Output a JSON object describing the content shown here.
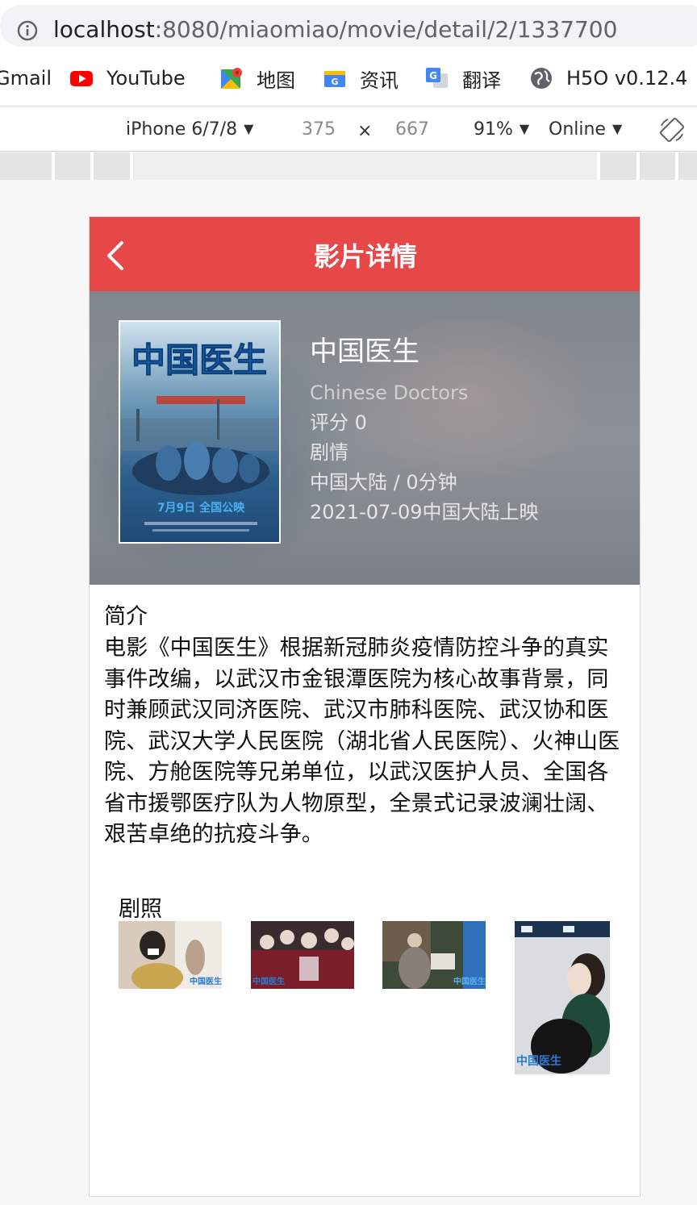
{
  "browser": {
    "url_host": "localhost",
    "url_rest": ":8080/miaomiao/movie/detail/2/1337700",
    "bookmarks": [
      {
        "label": "Gmail",
        "icon": "gmail-icon"
      },
      {
        "label": "YouTube",
        "icon": "youtube-icon"
      },
      {
        "label": "地图",
        "icon": "maps-icon"
      },
      {
        "label": "资讯",
        "icon": "news-icon"
      },
      {
        "label": "翻译",
        "icon": "translate-icon"
      },
      {
        "label": "H5O v0.12.4",
        "icon": "globe-icon"
      }
    ],
    "devtools": {
      "device": "iPhone 6/7/8",
      "width": "375",
      "times": "×",
      "height": "667",
      "zoom": "91%",
      "network": "Online",
      "dropdown_glyph": "▼"
    }
  },
  "app": {
    "header_title": "影片详情",
    "movie": {
      "name": "中国医生",
      "english_name": "Chinese Doctors",
      "score": "评分 0",
      "genre": "剧情",
      "region_duration": "中国大陆 / 0分钟",
      "release": "2021-07-09中国大陆上映"
    },
    "intro_label": "简介",
    "intro_text": "电影《中国医生》根据新冠肺炎疫情防控斗争的真实事件改编，以武汉市金银潭医院为核心故事背景，同时兼顾武汉同济医院、武汉市肺科医院、武汉协和医院、武汉大学人民医院（湖北省人民医院）、火神山医院、方舱医院等兄弟单位，以武汉医护人员、全国各省市援鄂医疗队为人物原型，全景式记录波澜壮阔、艰苦卓绝的抗疫斗争。",
    "stills_label": "剧照",
    "colors": {
      "header": "#e54847",
      "hero_bg": "#8b9096"
    }
  }
}
